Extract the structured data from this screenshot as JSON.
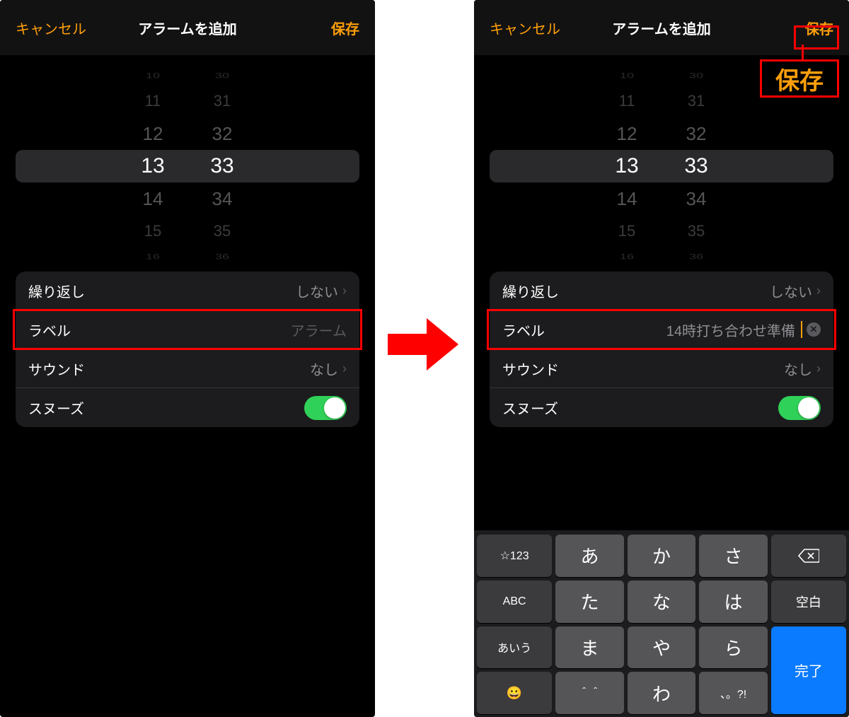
{
  "nav": {
    "cancel": "キャンセル",
    "title": "アラームを追加",
    "save": "保存"
  },
  "picker": {
    "hours": [
      "10",
      "11",
      "12",
      "13",
      "14",
      "15",
      "16"
    ],
    "minutes": [
      "30",
      "31",
      "32",
      "33",
      "34",
      "35",
      "36"
    ],
    "selected_hour": "13",
    "selected_minute": "33"
  },
  "settings": {
    "repeat": {
      "label": "繰り返し",
      "value": "しない"
    },
    "label": {
      "label": "ラベル",
      "placeholder": "アラーム",
      "value": "14時打ち合わせ準備"
    },
    "sound": {
      "label": "サウンド",
      "value": "なし"
    },
    "snooze": {
      "label": "スヌーズ",
      "on": true
    }
  },
  "callout": {
    "text": "保存"
  },
  "keyboard": {
    "rows": [
      [
        "☆123",
        "あ",
        "か",
        "さ",
        "⌫"
      ],
      [
        "ABC",
        "た",
        "な",
        "は",
        "空白"
      ],
      [
        "あいう",
        "ま",
        "や",
        "ら",
        "完了"
      ],
      [
        "😀",
        "＾＾",
        "わ",
        "、。?!",
        ""
      ]
    ]
  },
  "colors": {
    "accent": "#ff9f0a",
    "highlight": "#ff0000",
    "toggle_on": "#30d158",
    "done_key": "#0a7bff"
  }
}
